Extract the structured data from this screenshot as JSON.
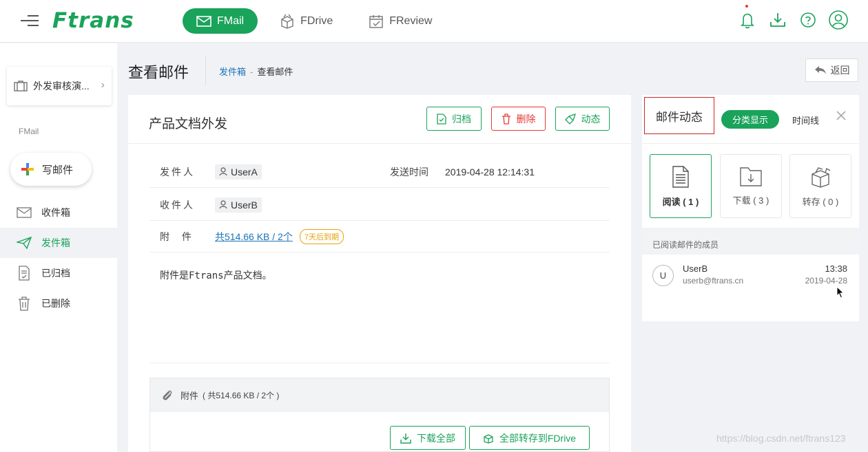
{
  "header": {
    "logo": "Ftrans",
    "apps": [
      {
        "label": "FMail",
        "icon": "mail-icon",
        "active": true
      },
      {
        "label": "FDrive",
        "icon": "box-icon",
        "active": false
      },
      {
        "label": "FReview",
        "icon": "calendar-check-icon",
        "active": false
      }
    ],
    "icons": [
      "bell-icon",
      "download-icon",
      "help-icon",
      "user-icon"
    ],
    "accent": "#1aa35a"
  },
  "sidebar": {
    "project": "外发审核演...",
    "section": "FMail",
    "compose": "写邮件",
    "items": [
      {
        "label": "收件箱",
        "icon": "inbox-icon",
        "active": false
      },
      {
        "label": "发件箱",
        "icon": "send-icon",
        "active": true
      },
      {
        "label": "已归档",
        "icon": "archive-icon",
        "active": false
      },
      {
        "label": "已删除",
        "icon": "trash-icon",
        "active": false
      }
    ]
  },
  "page": {
    "title": "查看邮件",
    "breadcrumb": {
      "parent": "发件箱",
      "sep": "-",
      "current": "查看邮件"
    },
    "back": "返回"
  },
  "mail": {
    "subject": "产品文档外发",
    "actions": {
      "archive": "归档",
      "delete": "删除",
      "activity": "动态"
    },
    "sender_label": "发件人",
    "sender": "UserA",
    "sent_time_label": "发送时间",
    "sent_time": "2019-04-28 12:14:31",
    "recipient_label": "收件人",
    "recipient": "UserB",
    "attach_label": "附 件",
    "attach_summary": "共514.66 KB / 2个",
    "expire": "7天后到期",
    "body": "附件是Ftrans产品文档。",
    "attach_box": {
      "title": "附件",
      "count": "( 共514.66 KB / 2个 )",
      "download_all": "下载全部",
      "save_all": "全部转存到FDrive"
    }
  },
  "activity": {
    "title": "邮件动态",
    "view_grouped": "分类显示",
    "view_timeline": "时间线",
    "stats": [
      {
        "label": "阅读 ( 1 )",
        "icon": "document-icon",
        "active": true
      },
      {
        "label": "下载 ( 3 )",
        "icon": "folder-download-icon",
        "active": false
      },
      {
        "label": "转存 ( 0 )",
        "icon": "box-icon",
        "active": false
      }
    ],
    "readers_title": "已阅读邮件的成员",
    "readers": [
      {
        "avatar": "U",
        "name": "UserB",
        "email": "userb@ftrans.cn",
        "time": "13:38",
        "date": "2019-04-28"
      }
    ]
  },
  "watermark": "https://blog.csdn.net/ftrans123"
}
